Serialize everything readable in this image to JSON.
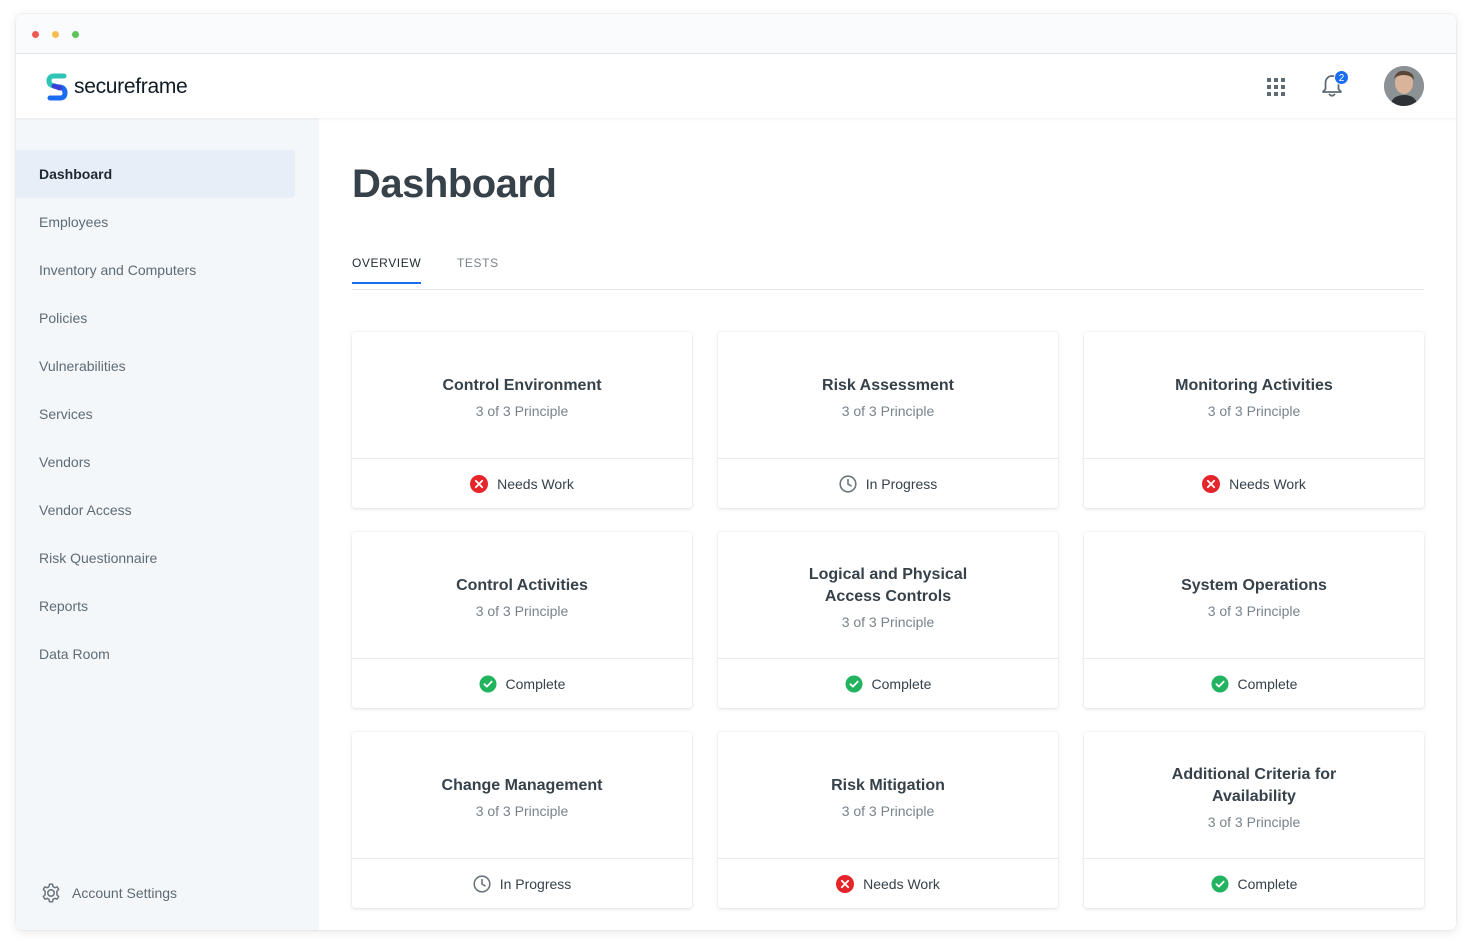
{
  "header": {
    "brand": "secureframe",
    "notification_count": "2",
    "colors": {
      "brand_blue": "#1a6cf0",
      "brand_teal": "#2ec4b6"
    }
  },
  "sidebar": {
    "items": [
      {
        "label": "Dashboard",
        "active": true
      },
      {
        "label": "Employees"
      },
      {
        "label": "Inventory and Computers"
      },
      {
        "label": "Policies"
      },
      {
        "label": "Vulnerabilities"
      },
      {
        "label": "Services"
      },
      {
        "label": "Vendors"
      },
      {
        "label": "Vendor Access"
      },
      {
        "label": "Risk Questionnaire"
      },
      {
        "label": "Reports"
      },
      {
        "label": "Data Room"
      }
    ],
    "account_settings": "Account Settings"
  },
  "main": {
    "title": "Dashboard",
    "tabs": [
      {
        "label": "OVERVIEW",
        "active": true
      },
      {
        "label": "TESTS"
      }
    ],
    "cards": [
      {
        "title": "Control Environment",
        "subtitle": "3 of 3 Principle",
        "status": "Needs Work",
        "status_icon": "x-circle-icon"
      },
      {
        "title": "Risk Assessment",
        "subtitle": "3 of 3 Principle",
        "status": "In Progress",
        "status_icon": "clock-icon"
      },
      {
        "title": "Monitoring Activities",
        "subtitle": "3 of 3 Principle",
        "status": "Needs Work",
        "status_icon": "x-circle-icon"
      },
      {
        "title": "Control Activities",
        "subtitle": "3 of 3 Principle",
        "status": "Complete",
        "status_icon": "check-circle-icon"
      },
      {
        "title": "Logical and Physical Access Controls",
        "subtitle": "3 of 3 Principle",
        "status": "Complete",
        "status_icon": "check-circle-icon"
      },
      {
        "title": "System Operations",
        "subtitle": "3 of 3 Principle",
        "status": "Complete",
        "status_icon": "check-circle-icon"
      },
      {
        "title": "Change Management",
        "subtitle": "3 of 3 Principle",
        "status": "In Progress",
        "status_icon": "clock-icon"
      },
      {
        "title": "Risk Mitigation",
        "subtitle": "3 of 3 Principle",
        "status": "Needs Work",
        "status_icon": "x-circle-icon"
      },
      {
        "title": "Additional Criteria for Availability",
        "subtitle": "3 of 3 Principle",
        "status": "Complete",
        "status_icon": "check-circle-icon"
      }
    ],
    "status_colors": {
      "Needs Work": "#e5252a",
      "In Progress": "#6b757c",
      "Complete": "#22b35e"
    }
  }
}
